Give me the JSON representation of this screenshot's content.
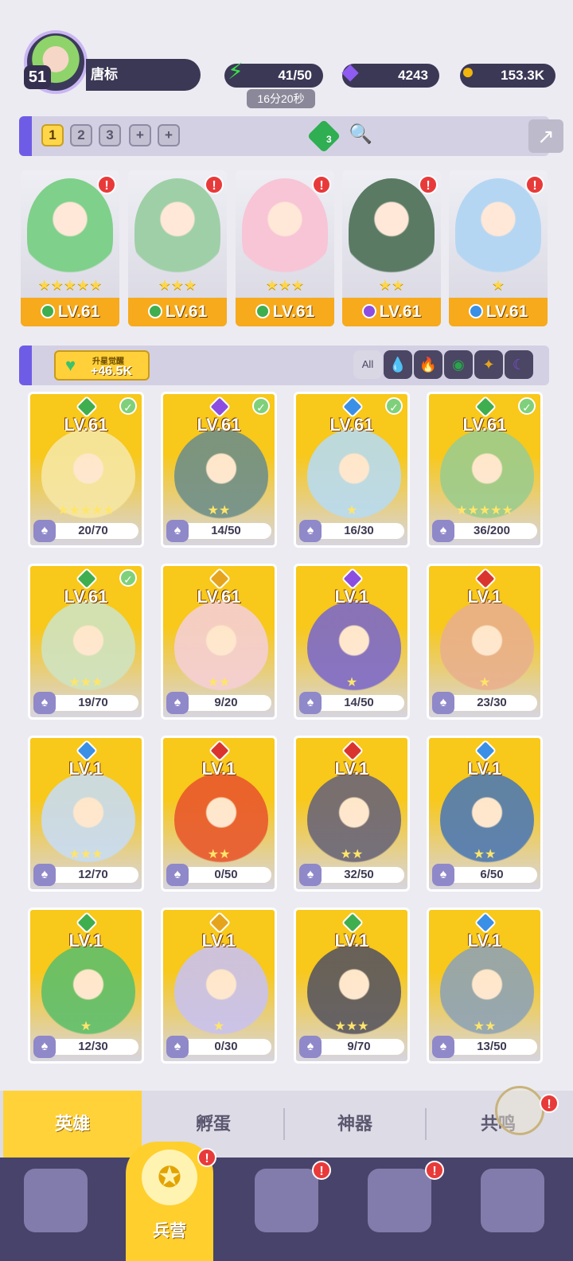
{
  "player": {
    "level": "51",
    "name": "唐标"
  },
  "resources": {
    "energy": "41/50",
    "energy_timer": "16分20秒",
    "diamonds": "4243",
    "gold": "153.3K"
  },
  "team_slots": {
    "labels": [
      "1",
      "2",
      "3",
      "+",
      "+"
    ],
    "active": 0,
    "gem_count": "3"
  },
  "team": [
    {
      "level": "LV.61",
      "stars": "★★★★★",
      "element": "green",
      "color": "#3fae4e",
      "art": "#7fd08a"
    },
    {
      "level": "LV.61",
      "stars": "★★★",
      "element": "green",
      "color": "#3fae4e",
      "art": "#9fcfa6"
    },
    {
      "level": "LV.61",
      "stars": "★★★",
      "element": "green",
      "color": "#3fae4e",
      "art": "#f7c5d5"
    },
    {
      "level": "LV.61",
      "stars": "★★",
      "element": "purple",
      "color": "#8b4ee0",
      "art": "#5a7a64"
    },
    {
      "level": "LV.61",
      "stars": "★",
      "element": "blue",
      "color": "#3a8fe6",
      "art": "#b5d6f2"
    }
  ],
  "awaken": {
    "title": "升星觉醒",
    "value": "+46.5K"
  },
  "filters": [
    {
      "name": "all",
      "label": "All",
      "color": "#d9d7e3"
    },
    {
      "name": "water",
      "label": "💧",
      "color": "#2f7bd6"
    },
    {
      "name": "fire",
      "label": "🔥",
      "color": "#d9352e"
    },
    {
      "name": "wind",
      "label": "◉",
      "color": "#2aa44a"
    },
    {
      "name": "light",
      "label": "✦",
      "color": "#e6a41c"
    },
    {
      "name": "dark",
      "label": "☾",
      "color": "#7e4bd8"
    }
  ],
  "heroes": [
    {
      "level": "LV.61",
      "progress": "20/70",
      "element_color": "#3fae4e",
      "checked": true,
      "stars": "★★★★★",
      "art": "#f6e7a4"
    },
    {
      "level": "LV.61",
      "progress": "14/50",
      "element_color": "#8b4ee0",
      "checked": true,
      "stars": "★★",
      "art": "#6f8f88"
    },
    {
      "level": "LV.61",
      "progress": "16/30",
      "element_color": "#3a8fe6",
      "checked": true,
      "stars": "★",
      "art": "#b8dbf0"
    },
    {
      "level": "LV.61",
      "progress": "36/200",
      "element_color": "#3fae4e",
      "checked": true,
      "stars": "★★★★★",
      "art": "#9ccc8c"
    },
    {
      "level": "LV.61",
      "progress": "19/70",
      "element_color": "#3fae4e",
      "checked": true,
      "stars": "★★★",
      "art": "#cfe3c0"
    },
    {
      "level": "LV.61",
      "progress": "9/20",
      "element_color": "#e6a41c",
      "checked": false,
      "stars": "★★",
      "art": "#f5cfd4"
    },
    {
      "level": "LV.1",
      "progress": "14/50",
      "element_color": "#8b4ee0",
      "checked": false,
      "stars": "★",
      "art": "#7d6ac8"
    },
    {
      "level": "LV.1",
      "progress": "23/30",
      "element_color": "#d9352e",
      "checked": false,
      "stars": "★",
      "art": "#e9b08c"
    },
    {
      "level": "LV.1",
      "progress": "12/70",
      "element_color": "#3a8fe6",
      "checked": false,
      "stars": "★★★",
      "art": "#c8dcf2"
    },
    {
      "level": "LV.1",
      "progress": "0/50",
      "element_color": "#d9352e",
      "checked": false,
      "stars": "★★",
      "art": "#e8582c"
    },
    {
      "level": "LV.1",
      "progress": "32/50",
      "element_color": "#d9352e",
      "checked": false,
      "stars": "★★",
      "art": "#6a6577"
    },
    {
      "level": "LV.1",
      "progress": "6/50",
      "element_color": "#3a8fe6",
      "checked": false,
      "stars": "★★",
      "art": "#4f7ab2"
    },
    {
      "level": "LV.1",
      "progress": "12/30",
      "element_color": "#3fae4e",
      "checked": false,
      "stars": "★",
      "art": "#5fbf6a"
    },
    {
      "level": "LV.1",
      "progress": "0/30",
      "element_color": "#e6a41c",
      "checked": false,
      "stars": "★",
      "art": "#c9c2ef"
    },
    {
      "level": "LV.1",
      "progress": "9/70",
      "element_color": "#3fae4e",
      "checked": false,
      "stars": "★★★",
      "art": "#59565f"
    },
    {
      "level": "LV.1",
      "progress": "13/50",
      "element_color": "#3a8fe6",
      "checked": false,
      "stars": "★★",
      "art": "#8fa3b3"
    }
  ],
  "tabs": [
    {
      "label": "英雄"
    },
    {
      "label": "孵蛋"
    },
    {
      "label": "神器"
    },
    {
      "label": "共鸣"
    }
  ],
  "nav": {
    "center_label": "兵营"
  },
  "colors": {
    "accent_yellow": "#ffd23a",
    "panel_purple": "#6f5ce6",
    "dark": "#3b3856",
    "alert_red": "#e83a3a"
  }
}
